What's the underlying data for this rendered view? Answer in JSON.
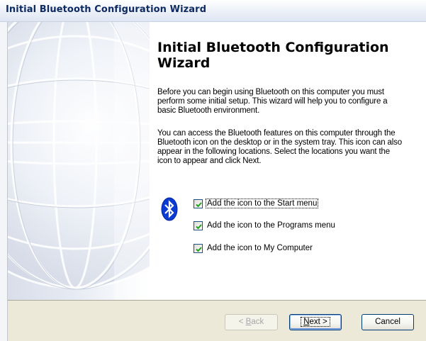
{
  "window": {
    "title": "Initial Bluetooth Configuration Wizard"
  },
  "main": {
    "heading": "Initial Bluetooth Configuration Wizard",
    "paragraph1": "Before you can begin using Bluetooth on this computer you must perform some initial setup. This wizard will help you to configure a basic Bluetooth environment.",
    "paragraph2": "You can access the Bluetooth features on this computer through the Bluetooth icon on the desktop or in the system tray. This icon can also appear in the following locations. Select the locations you want the icon to appear and click Next."
  },
  "options": [
    {
      "label": "Add the icon to the Start menu",
      "checked": true,
      "focused": true
    },
    {
      "label": "Add the icon to the Programs menu",
      "checked": true,
      "focused": false
    },
    {
      "label": "Add the icon to My Computer",
      "checked": true,
      "focused": false
    }
  ],
  "buttons": {
    "back": {
      "prefix": "< ",
      "mnemonic": "B",
      "rest": "ack",
      "enabled": false
    },
    "next": {
      "mnemonic": "N",
      "rest": "ext >",
      "enabled": true,
      "default": true
    },
    "cancel": {
      "label": "Cancel",
      "enabled": true
    }
  },
  "icons": {
    "bluetooth": "bluetooth-icon",
    "watermark": "globe-watermark",
    "check": "checkmark-icon"
  },
  "colors": {
    "title_text": "#0e2a63",
    "bluetooth_blue": "#0a3bd3",
    "check_green": "#21a121",
    "dialog_face": "#ece9d8",
    "button_border": "#003c74"
  }
}
